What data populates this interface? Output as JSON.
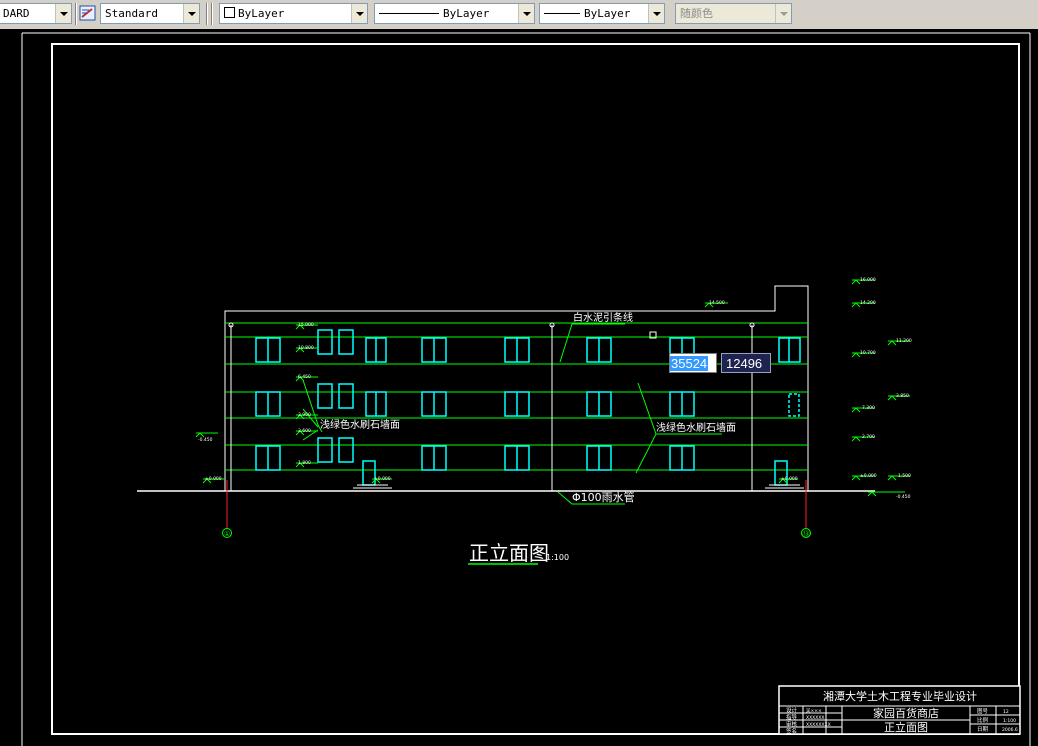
{
  "toolbar": {
    "text_style_value": "DARD",
    "dim_style_value": "Standard",
    "layer_value": "ByLayer",
    "linetype_value": "ByLayer",
    "lineweight_value": "ByLayer",
    "color_value": "随颜色"
  },
  "colors": {
    "background": "#000000",
    "cyan": "#00ffff",
    "green": "#00ff00",
    "white": "#ffffff"
  },
  "drawing": {
    "title": "正立面图",
    "scale": "1:100",
    "annotations": {
      "top_label": "白水泥引条线",
      "left_wall": "浅绿色水刷石墙面",
      "right_wall": "浅绿色水刷石墙面",
      "downpipe": "Φ100雨水管"
    },
    "axis_left": "①",
    "axis_right": "⑬",
    "elevations_left": [
      "15.000",
      "10.800",
      "6.450",
      "3.900",
      "3.600",
      "1.800",
      "±0.000",
      "-0.450"
    ],
    "elevations_right": [
      "16.000",
      "14.200",
      "10.700",
      "7.300",
      "2.700",
      "1.500",
      "±0.000",
      "-0.450",
      "11.200",
      "3.850",
      "14.500"
    ]
  },
  "dim_input": {
    "x_value": "35524",
    "y_value": "12496"
  },
  "title_block": {
    "school_line": "湘潭大学土木工程专业毕业设计",
    "project_name": "家园百货商店",
    "drawing_name": "正立面图",
    "left_rows": [
      {
        "role": "设计",
        "name": "吴×××"
      },
      {
        "role": "指导",
        "name": "XXXXXX"
      },
      {
        "role": "审核",
        "name": "XXXXXXXX"
      },
      {
        "role": "签名",
        "name": ""
      }
    ],
    "right_rows": [
      {
        "label": "图号",
        "value": "12"
      },
      {
        "label": "比例",
        "value": "1:100"
      },
      {
        "label": "日期",
        "value": "2006.6"
      }
    ]
  }
}
